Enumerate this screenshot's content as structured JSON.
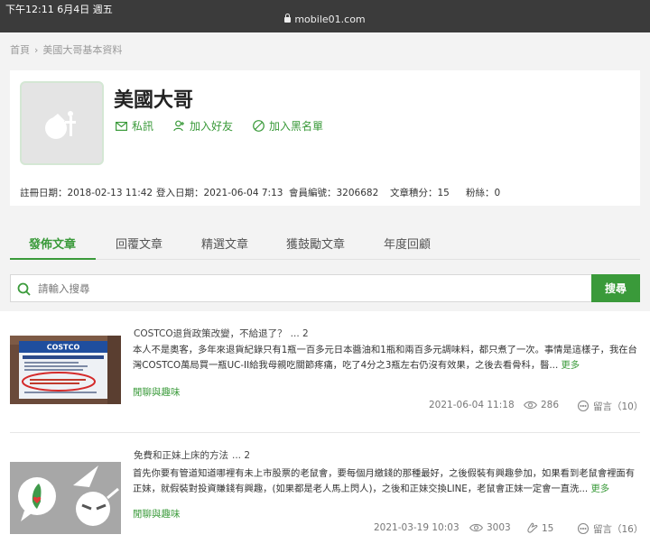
{
  "statusbar": {
    "time": "下午12:11   6月4日 週五",
    "url": "mobile01.com"
  },
  "breadcrumb": {
    "home": "首頁",
    "sep": "›",
    "current": "美國大哥基本資料"
  },
  "profile": {
    "username": "美國大哥",
    "actions": {
      "message": "私訊",
      "add_friend": "加入好友",
      "blacklist": "加入黑名單"
    },
    "stats": {
      "registered": "註冊日期：2018-02-13 11:42",
      "last_login": "登入日期：2021-06-04 7:13",
      "member_no": "會員編號：3206682",
      "score": "文章積分：15",
      "fans": "粉絲：0"
    }
  },
  "tabs": [
    "發佈文章",
    "回覆文章",
    "精選文章",
    "獲鼓勵文章",
    "年度回顧"
  ],
  "search": {
    "placeholder": "請輸入搜尋",
    "button": "搜尋"
  },
  "posts": [
    {
      "title": "COSTCO退貨政策改變，不給退了？",
      "page_count": "... 2",
      "excerpt": "本人不是奧客，多年來退貨紀錄只有1瓶一百多元日本醬油和1瓶和兩百多元調味料，都只煮了一次。事情是這樣子，我在台灣COSTCO萬局買一瓶UC-II給我母親吃關節疼痛，吃了4分之3瓶左右仍沒有效果，之後去看骨科，醫...",
      "more": "更多",
      "tag": "閒聊與趣味",
      "date": "2021-06-04 11:18",
      "views": "286",
      "comments": "留言（10）"
    },
    {
      "title": "免費和正妹上床的方法",
      "page_count": "... 2",
      "excerpt": "首先你要有管道知道哪裡有未上市股票的老鼠會，要每個月繳錢的那種最好，之後假裝有興趣參加，如果看到老鼠會裡面有正妹，就假裝對投資賺錢有興趣，(如果都是老人馬上閃人)，之後和正妹交換LINE，老鼠會正妹一定會一直洗...",
      "more": "更多",
      "tag": "閒聊與趣味",
      "date": "2021-03-19 10:03",
      "views": "3003",
      "likes": "15",
      "comments": "留言（16）"
    }
  ],
  "colors": {
    "accent": "#3a9a3a",
    "statusbar": "#3b3b3b",
    "page_bg": "#f3f3f3"
  },
  "icons": [
    "search-icon",
    "mail-icon",
    "add-user-icon",
    "block-icon",
    "eye-icon",
    "comment-icon",
    "clap-icon",
    "lock-icon"
  ]
}
